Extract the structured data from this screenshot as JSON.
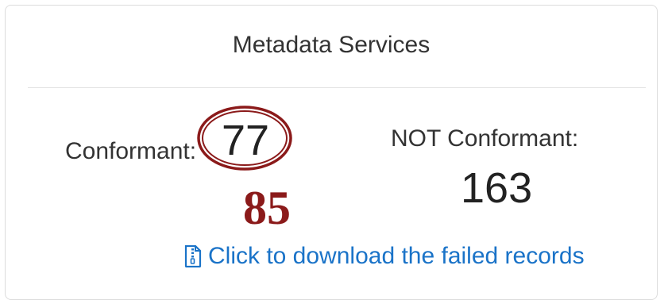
{
  "card": {
    "title": "Metadata Services"
  },
  "conformant": {
    "label": "Conformant:",
    "value": "77",
    "annotation": "85"
  },
  "not_conformant": {
    "label": "NOT Conformant:",
    "value": "163"
  },
  "download": {
    "label": "Click to download the failed records",
    "icon": "file-zipper-icon"
  },
  "colors": {
    "link": "#1a73c8",
    "annotation": "#8b1a1a",
    "border": "#dcdcdc"
  }
}
